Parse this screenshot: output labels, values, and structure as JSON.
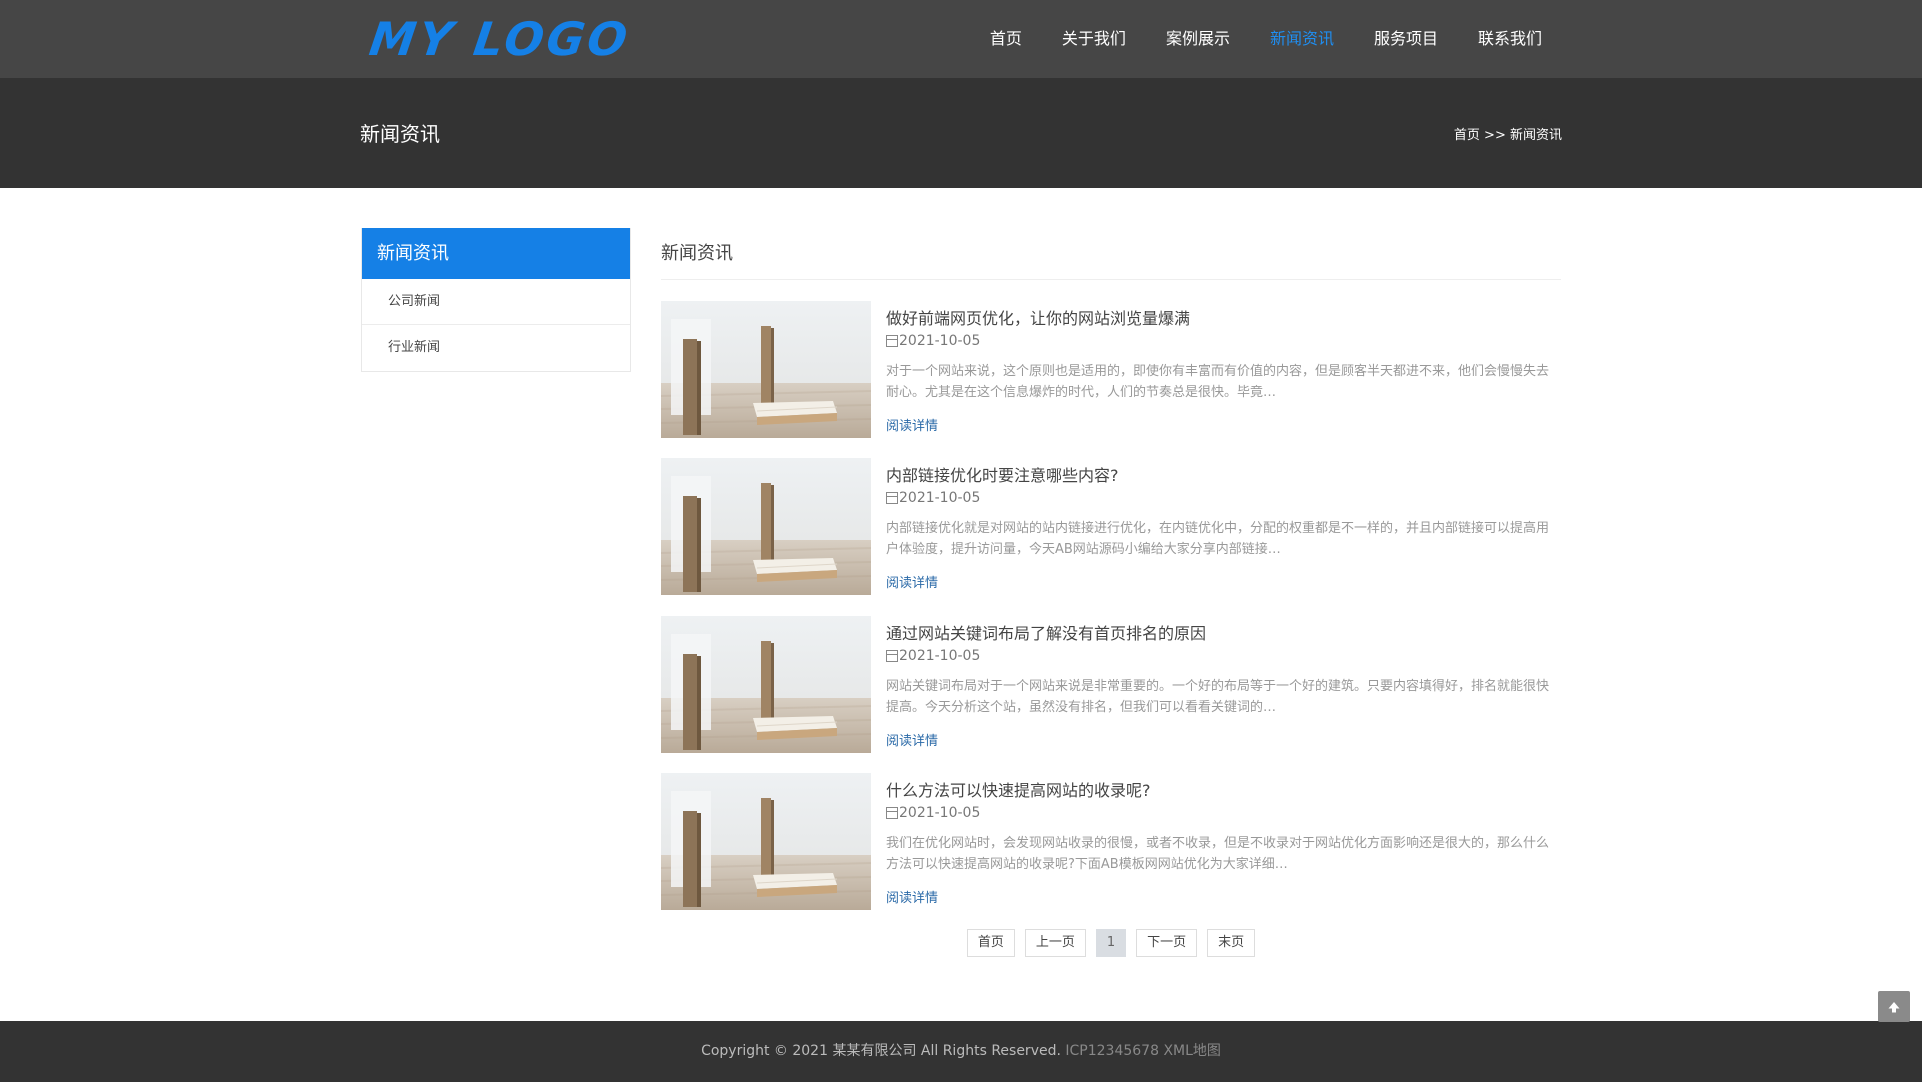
{
  "header": {
    "logo_text": "MY LOGO",
    "nav": [
      {
        "label": "首页"
      },
      {
        "label": "关于我们"
      },
      {
        "label": "案例展示"
      },
      {
        "label": "新闻资讯"
      },
      {
        "label": "服务项目"
      },
      {
        "label": "联系我们"
      }
    ],
    "active_nav": "新闻资讯"
  },
  "banner": {
    "title": "新闻资讯",
    "breadcrumb_home": "首页",
    "breadcrumb_sep": " >> ",
    "breadcrumb_current": "新闻资讯"
  },
  "sidebar": {
    "title": "新闻资讯",
    "items": [
      {
        "label": "公司新闻"
      },
      {
        "label": "行业新闻"
      }
    ]
  },
  "main": {
    "title": "新闻资讯",
    "articles": [
      {
        "title": "做好前端网页优化，让你的网站浏览量爆满",
        "date": "2021-10-05",
        "desc": "对于一个网站来说，这个原则也是适用的，即使你有丰富而有价值的内容，但是顾客半天都进不来，他们会慢慢失去耐心。尤其是在这个信息爆炸的时代，人们的节奏总是很快。毕竟…",
        "more": "阅读详情"
      },
      {
        "title": "内部链接优化时要注意哪些内容?",
        "date": "2021-10-05",
        "desc": "内部链接优化就是对网站的站内链接进行优化，在内链优化中，分配的权重都是不一样的，并且内部链接可以提高用户体验度，提升访问量，今天AB网站源码小编给大家分享内部链接…",
        "more": "阅读详情"
      },
      {
        "title": "通过网站关键词布局了解没有首页排名的原因",
        "date": "2021-10-05",
        "desc": "网站关键词布局对于一个网站来说是非常重要的。一个好的布局等于一个好的建筑。只要内容填得好，排名就能很快提高。今天分析这个站，虽然没有排名，但我们可以看看关键词的…",
        "more": "阅读详情"
      },
      {
        "title": "什么方法可以快速提高网站的收录呢?",
        "date": "2021-10-05",
        "desc": "我们在优化网站时，会发现网站收录的很慢，或者不收录，但是不收录对于网站优化方面影响还是很大的，那么什么方法可以快速提高网站的收录呢?下面AB模板网网站优化为大家详细…",
        "more": "阅读详情"
      }
    ],
    "pager": {
      "first": "首页",
      "prev": "上一页",
      "current": "1",
      "next": "下一页",
      "last": "末页"
    }
  },
  "footer": {
    "copyright": "Copyright © 2021 某某有限公司 All Rights Reserved.",
    "icp": "ICP12345678",
    "sitemap": "XML地图"
  },
  "icons": {
    "calendar": "calendar-icon",
    "back_to_top": "arrow-up-icon"
  },
  "colors": {
    "accent": "#1580e6",
    "nav_active": "#1f8ef1",
    "header_bg": "#464646",
    "banner_bg": "#333333",
    "link": "#2b6aa8"
  }
}
